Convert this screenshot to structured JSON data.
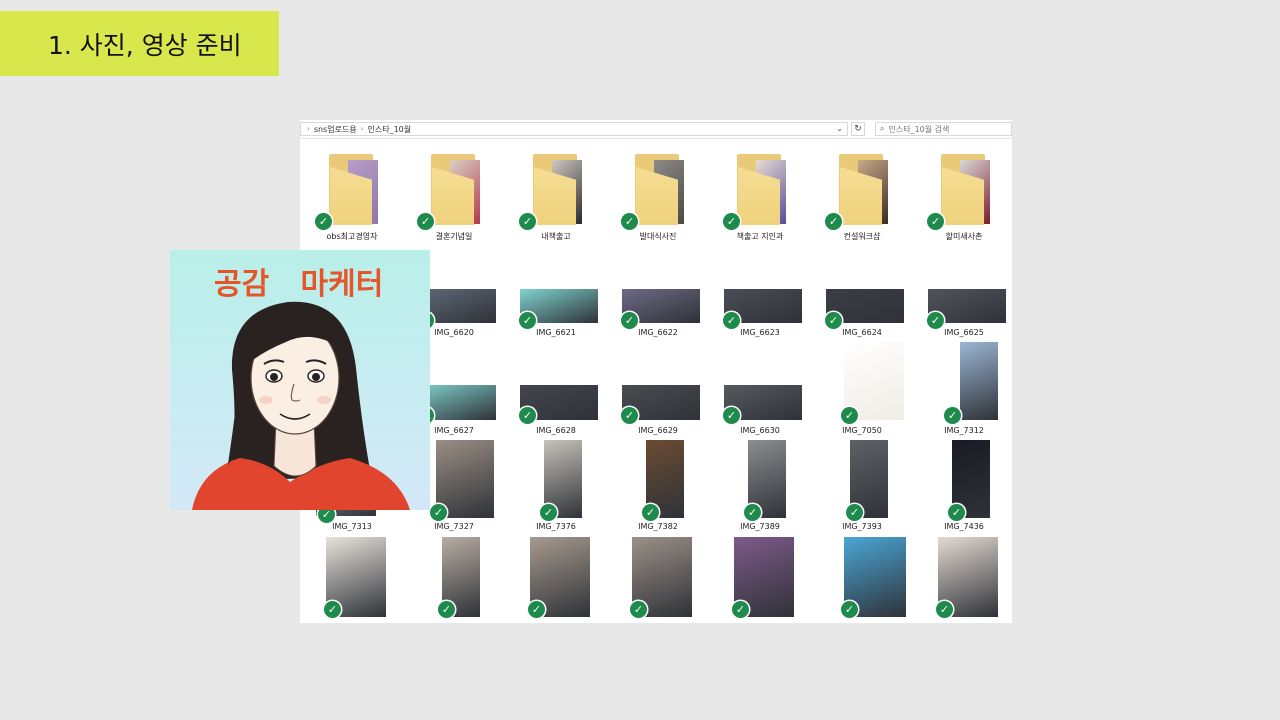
{
  "slide": {
    "title": "1. 사진, 영상 준비"
  },
  "explorer": {
    "breadcrumb": [
      "sns업로드용",
      "인스타_10월"
    ],
    "search_placeholder": "인스타_10월 검색",
    "folders": [
      {
        "label": "obs최고경영자",
        "color": "#b79fc9",
        "photo": "#8e77a8"
      },
      {
        "label": "결혼기념일",
        "color": "#d9cfc6",
        "photo": "#b23a4a"
      },
      {
        "label": "내책출고",
        "color": "#cfc7c2",
        "photo": "#2a2a2a"
      },
      {
        "label": "발대식사진",
        "color": "#8d8a88",
        "photo": "#4b4a4a"
      },
      {
        "label": "책출고 지인과",
        "color": "#e6ddd3",
        "photo": "#5a4b9a"
      },
      {
        "label": "컨설워크샵",
        "color": "#caa98a",
        "photo": "#3e2a22"
      },
      {
        "label": "할미새사촌",
        "color": "#d9d9d9",
        "photo": "#7a1d2a"
      }
    ],
    "row2": [
      {
        "label": "IMG_6620",
        "color": "#5e6a78"
      },
      {
        "label": "IMG_6621",
        "color": "#7fd3cf"
      },
      {
        "label": "IMG_6622",
        "color": "#6d6a86"
      },
      {
        "label": "IMG_6623",
        "color": "#4a4d55"
      },
      {
        "label": "IMG_6624",
        "color": "#3b3e45"
      },
      {
        "label": "IMG_6625",
        "color": "#51545b"
      }
    ],
    "row3": [
      {
        "label": "IMG_6627",
        "color": "#7fcfcb"
      },
      {
        "label": "IMG_6628",
        "color": "#43464d"
      },
      {
        "label": "IMG_6629",
        "color": "#4a4c52"
      },
      {
        "label": "IMG_6630",
        "color": "#565960"
      },
      {
        "label": "IMG_7050",
        "color": "#f0ece6"
      },
      {
        "label": "IMG_7312",
        "color": "#9bb6d3"
      }
    ],
    "row4": [
      {
        "label": "IMG_7313",
        "color": "#c9c9c9"
      },
      {
        "label": "IMG_7327",
        "color": "#9a8e84"
      },
      {
        "label": "IMG_7376",
        "color": "#c6c2ba"
      },
      {
        "label": "IMG_7382",
        "color": "#6b4b32"
      },
      {
        "label": "IMG_7389",
        "color": "#8b8d8f"
      },
      {
        "label": "IMG_7393",
        "color": "#5e6166"
      },
      {
        "label": "IMG_7436",
        "color": "#1a1a24"
      }
    ],
    "row5": [
      {
        "color": "#e8e3dc"
      },
      {
        "color": "#b8ada2"
      },
      {
        "color": "#a79a8e"
      },
      {
        "color": "#9c9088"
      },
      {
        "color": "#7e5a8a"
      },
      {
        "color": "#4aa6d6"
      },
      {
        "color": "#e4dad3"
      }
    ],
    "check_color": "#1e8a4c"
  },
  "avatar": {
    "caption": "공감   마케터",
    "caption_color": "#e8542a",
    "shirt_color": "#e2452e",
    "hair_color": "#2a2220"
  }
}
